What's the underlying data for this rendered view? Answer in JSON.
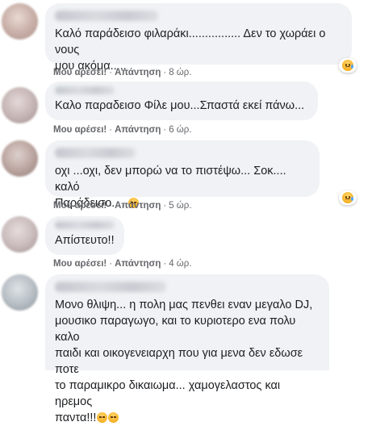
{
  "comments": [
    {
      "text": "Καλό παράδεισο φιλαράκι................ Δεν το χωράει ο νους\nμου ακόμα.....",
      "like_label": "Μου αρέσει!",
      "reply_label": "Απάντηση",
      "time": "8 ώρ.",
      "reaction": "sad-face"
    },
    {
      "text": "Καλο παραδεισο Φίλε μου...Σπαστά εκεί πάνω...",
      "like_label": "Μου αρέσει!",
      "reply_label": "Απάντηση",
      "time": "6 ώρ."
    },
    {
      "text": "οχι ...οχι, δεν μπορώ να το πιστέψω... Σοκ.... καλό\nΠαράδεισο.....",
      "like_label": "Μου αρέσει!",
      "reply_label": "Απάντηση",
      "time": "5 ώρ.",
      "reaction": "sad-face"
    },
    {
      "text": "Απίστευτο!!",
      "like_label": "Μου αρέσει!",
      "reply_label": "Απάντηση",
      "time": "4 ώρ."
    },
    {
      "text": "Μονο θλιψη... η πολη μας πενθει εναν μεγαλο DJ,\nμουσικο παραγωγο, και το κυριοτερο ενα πολυ καλο\nπαιδι και οικογενειαρχη που για μενα δεν εδωσε ποτε\nτο παραμικρο δικαιωμα... χαμογελαστος και ηρεμος\nπαντα!!!"
    }
  ],
  "separator": "·"
}
